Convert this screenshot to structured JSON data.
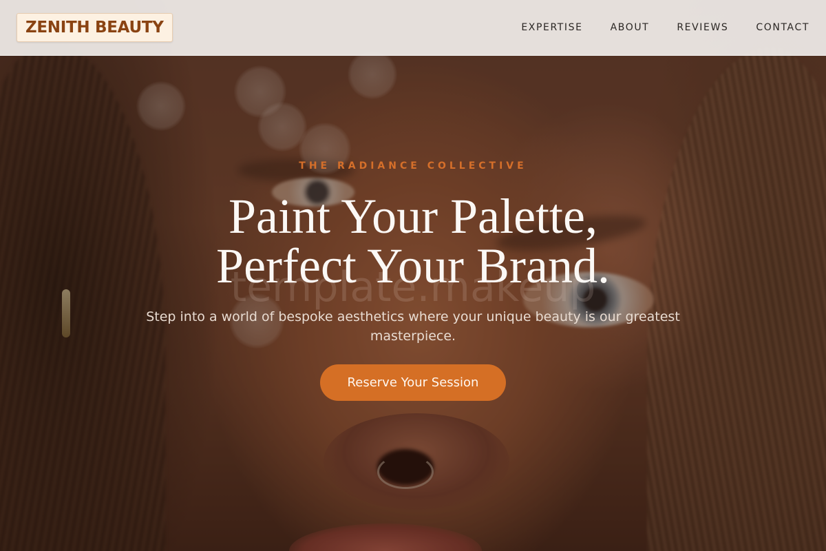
{
  "brand": {
    "name": "ZENITH BEAUTY"
  },
  "nav": {
    "items": [
      {
        "label": "EXPERTISE"
      },
      {
        "label": "ABOUT"
      },
      {
        "label": "REVIEWS"
      },
      {
        "label": "CONTACT"
      }
    ]
  },
  "hero": {
    "eyebrow": "THE RADIANCE COLLECTIVE",
    "headline_line1": "Paint Your Palette,",
    "headline_line2": "Perfect Your Brand.",
    "subhead": "Step into a world of bespoke aesthetics where your unique beauty is our greatest masterpiece.",
    "cta_label": "Reserve Your Session",
    "watermark": "template.makeup"
  },
  "colors": {
    "accent": "#d56f25",
    "brand_text": "#8a4312",
    "header_bg": "#eeeae7"
  }
}
